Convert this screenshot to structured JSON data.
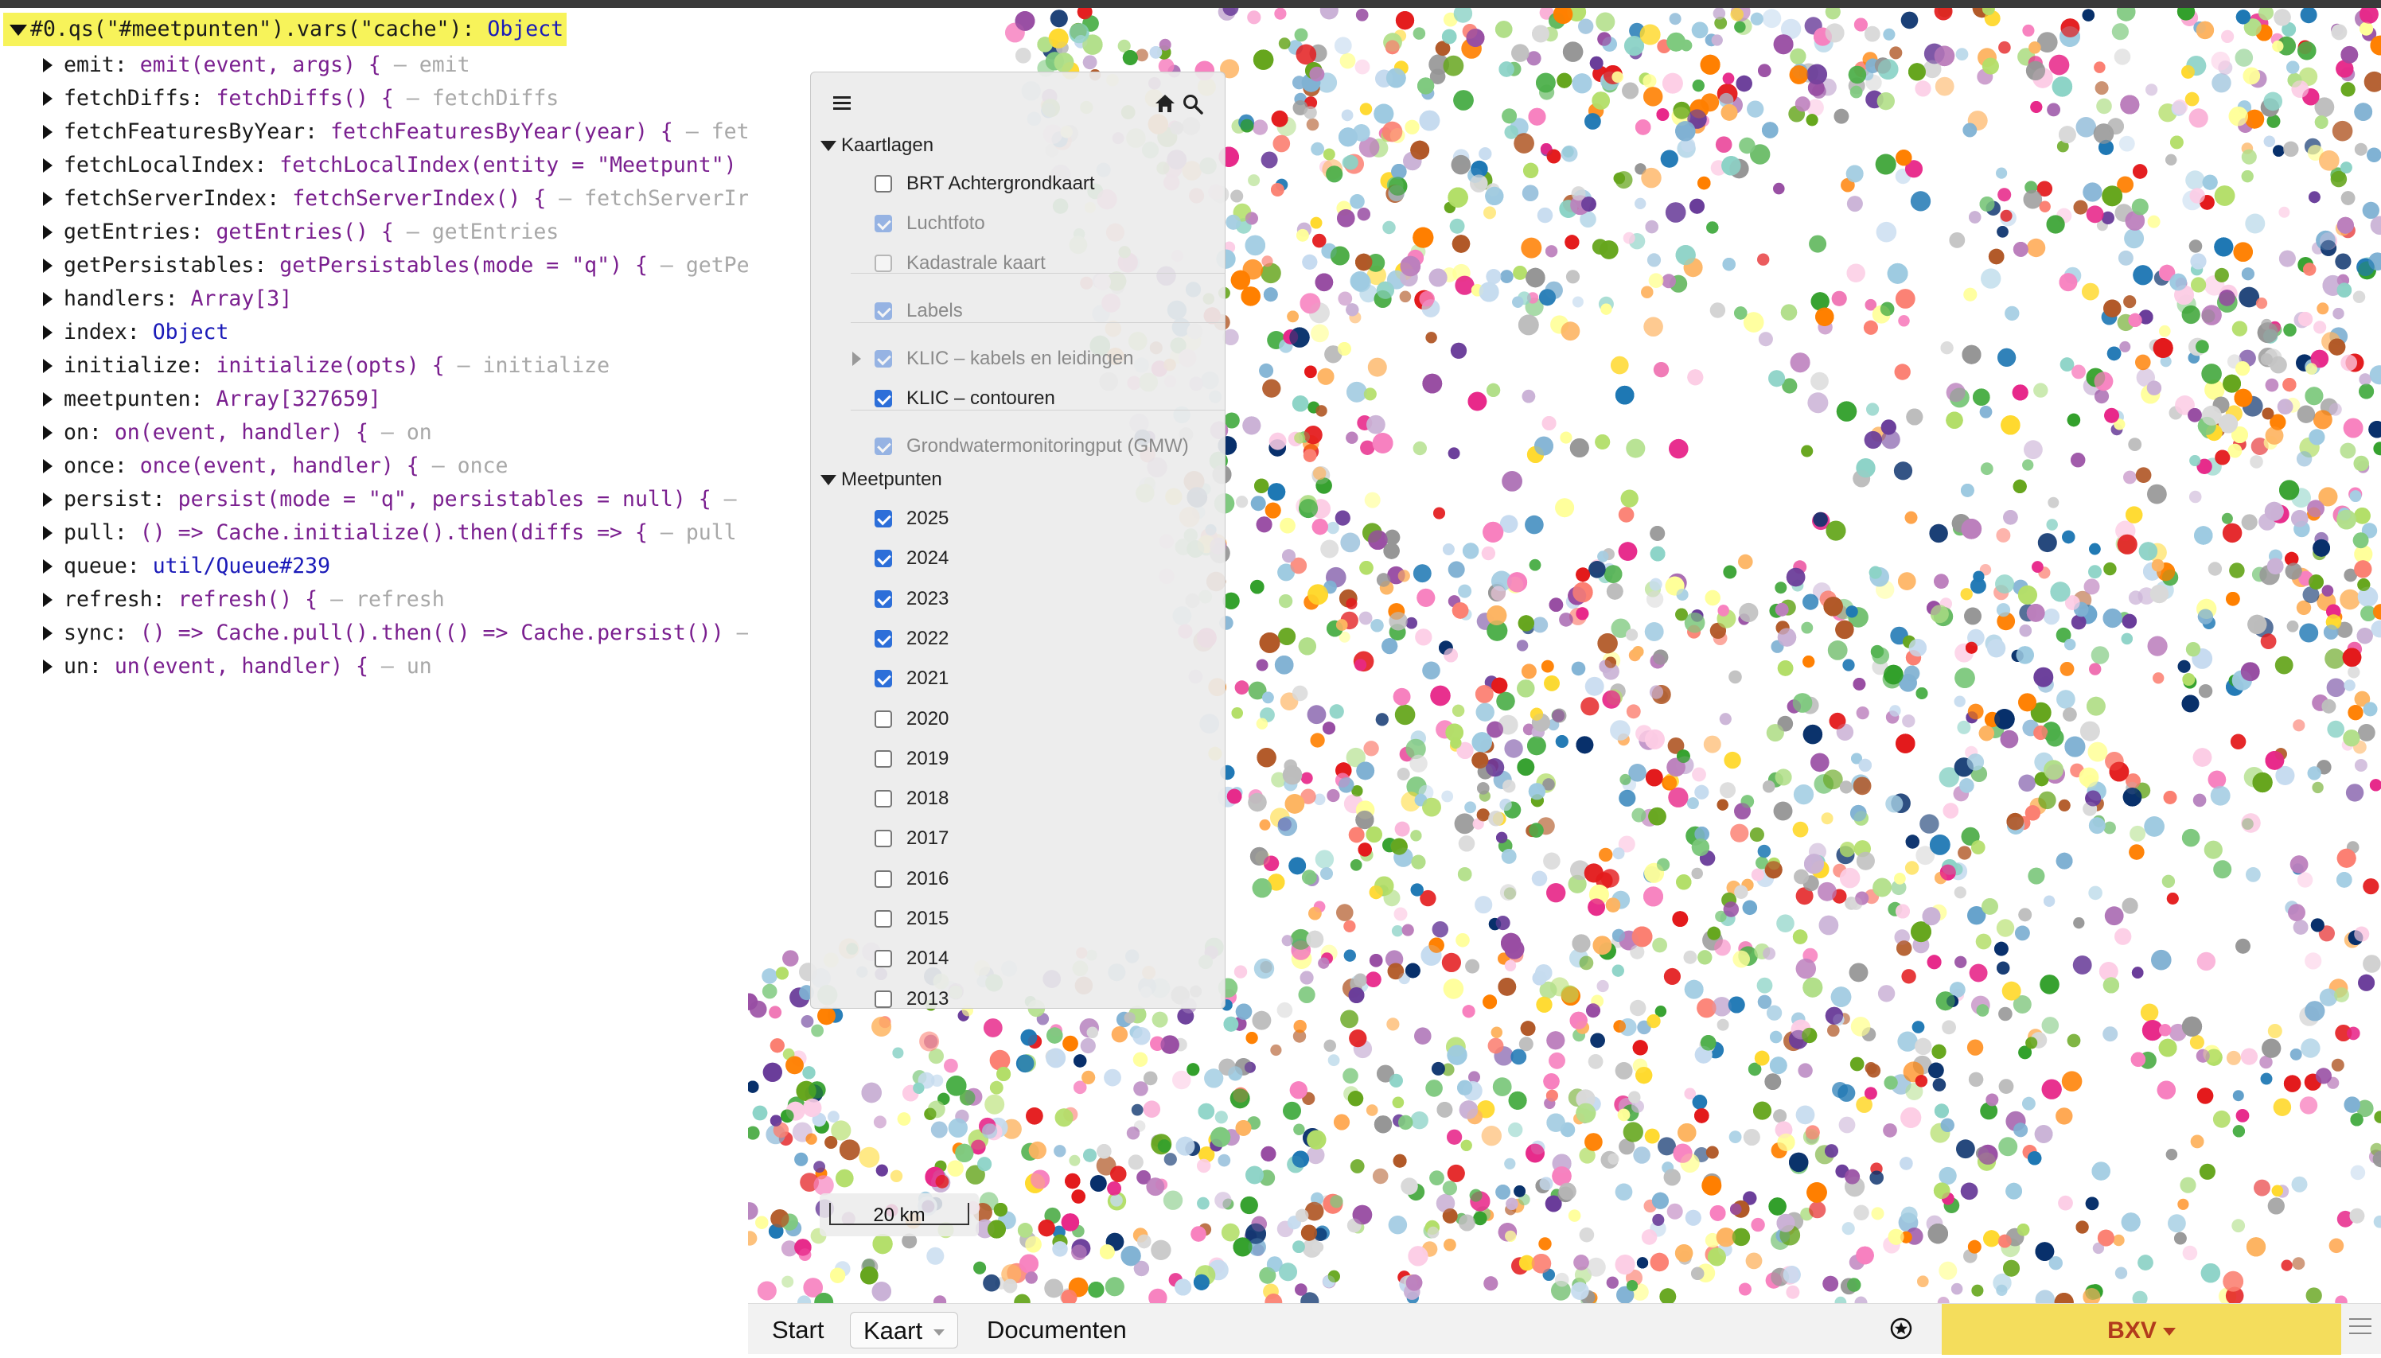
{
  "console": {
    "header_expr": "#0.qs(\"#meetpunten\").vars(\"cache\"):",
    "header_type": "Object",
    "props": [
      {
        "key": "emit:",
        "val": "emit(event, args) {",
        "cmt": "– emit",
        "kind": "fn"
      },
      {
        "key": "fetchDiffs:",
        "val": "fetchDiffs() {",
        "cmt": "– fetchDiffs",
        "kind": "fn"
      },
      {
        "key": "fetchFeaturesByYear:",
        "val": "fetchFeaturesByYear(year) {",
        "cmt": "– fet",
        "kind": "fn"
      },
      {
        "key": "fetchLocalIndex:",
        "val": "fetchLocalIndex(entity = \"Meetpunt\")",
        "cmt": "",
        "kind": "fn"
      },
      {
        "key": "fetchServerIndex:",
        "val": "fetchServerIndex() {",
        "cmt": "– fetchServerIr",
        "kind": "fn"
      },
      {
        "key": "getEntries:",
        "val": "getEntries() {",
        "cmt": "– getEntries",
        "kind": "fn"
      },
      {
        "key": "getPersistables:",
        "val": "getPersistables(mode = \"q\") {",
        "cmt": "– getPe",
        "kind": "fn"
      },
      {
        "key": "handlers:",
        "val": "Array[3]",
        "cmt": "",
        "kind": "fn"
      },
      {
        "key": "index:",
        "val": "Object",
        "cmt": "",
        "kind": "obj"
      },
      {
        "key": "initialize:",
        "val": "initialize(opts) {",
        "cmt": "– initialize",
        "kind": "fn"
      },
      {
        "key": "meetpunten:",
        "val": "Array[327659]",
        "cmt": "",
        "kind": "fn"
      },
      {
        "key": "on:",
        "val": "on(event, handler) {",
        "cmt": "– on",
        "kind": "fn"
      },
      {
        "key": "once:",
        "val": "once(event, handler) {",
        "cmt": "– once",
        "kind": "fn"
      },
      {
        "key": "persist:",
        "val": "persist(mode = \"q\", persistables = null) {",
        "cmt": "–",
        "kind": "fn"
      },
      {
        "key": "pull:",
        "val": "() => Cache.initialize().then(diffs => {",
        "cmt": "– pull",
        "kind": "fn"
      },
      {
        "key": "queue:",
        "val": "util/Queue#239",
        "cmt": "",
        "kind": "obj"
      },
      {
        "key": "refresh:",
        "val": "refresh() {",
        "cmt": "– refresh",
        "kind": "fn"
      },
      {
        "key": "sync:",
        "val": "() => Cache.pull().then(() => Cache.persist())",
        "cmt": "–",
        "kind": "fn"
      },
      {
        "key": "un:",
        "val": "un(event, handler) {",
        "cmt": "– un",
        "kind": "fn"
      }
    ]
  },
  "panel": {
    "menu_icon": "hamburger-icon",
    "home_icon": "home-icon",
    "search_icon": "search-icon",
    "group1": "Kaartlagen",
    "layers": [
      {
        "label": "BRT Achtergrondkaart",
        "checked": false,
        "dim": false
      },
      {
        "label": "Luchtfoto",
        "checked": true,
        "dim": true
      },
      {
        "label": "Kadastrale kaart",
        "checked": false,
        "dim": true
      },
      {
        "label": "Labels",
        "checked": true,
        "dim": true
      },
      {
        "label": "KLIC – kabels en leidingen",
        "checked": true,
        "dim": true
      },
      {
        "label": "KLIC – contouren",
        "checked": true,
        "dim": false
      },
      {
        "label": "Grondwatermonitoringput (GMW)",
        "checked": true,
        "dim": true
      }
    ],
    "group2": "Meetpunten",
    "years": [
      {
        "label": "2025",
        "checked": true
      },
      {
        "label": "2024",
        "checked": true
      },
      {
        "label": "2023",
        "checked": true
      },
      {
        "label": "2022",
        "checked": true
      },
      {
        "label": "2021",
        "checked": true
      },
      {
        "label": "2020",
        "checked": false
      },
      {
        "label": "2019",
        "checked": false
      },
      {
        "label": "2018",
        "checked": false
      },
      {
        "label": "2017",
        "checked": false
      },
      {
        "label": "2016",
        "checked": false
      },
      {
        "label": "2015",
        "checked": false
      },
      {
        "label": "2014",
        "checked": false
      },
      {
        "label": "2013",
        "checked": false
      }
    ]
  },
  "scale": {
    "label": "20 km"
  },
  "bottom": {
    "tab_start": "Start",
    "tab_kaart": "Kaart",
    "tab_documenten": "Documenten",
    "star_icon": "star-icon",
    "user_label": "BXV"
  },
  "colors": {
    "highlight": "#f7f35a",
    "checkbox": "#2d6fd9",
    "user_bg": "#f4dd5c",
    "user_text": "#b23b1c"
  }
}
